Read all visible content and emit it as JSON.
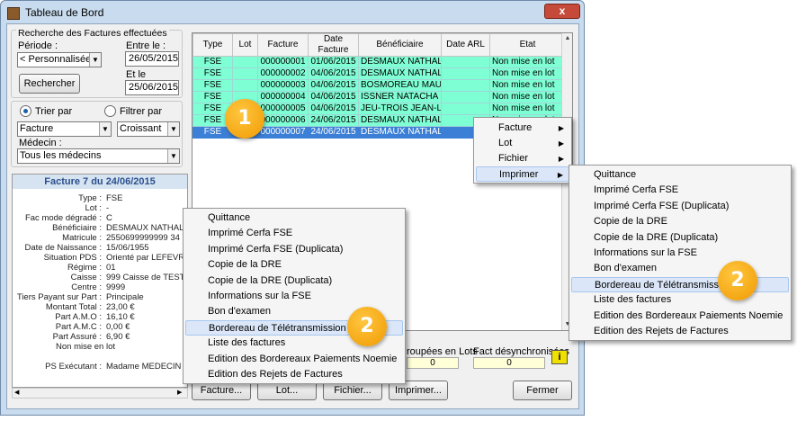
{
  "window": {
    "title": "Tableau de Bord",
    "close_label": "x"
  },
  "search": {
    "group_label": "Recherche des Factures effectuées",
    "periode_label": "Période :",
    "periode_value": "< Personnalisée >",
    "date_from_label": "Entre le :",
    "date_from_value": "26/05/2015",
    "date_to_label": "Et le",
    "date_to_value": "25/06/2015",
    "search_button": "Rechercher"
  },
  "sort": {
    "trier_label": "Trier par",
    "filtrer_label": "Filtrer par",
    "field_value": "Facture",
    "order_value": "Croissant",
    "medecin_label": "Médecin :",
    "medecin_value": "Tous les médecins"
  },
  "detail": {
    "header": "Facture 7  du 24/06/2015",
    "rows": [
      {
        "k": "Type :",
        "v": "FSE"
      },
      {
        "k": "Lot :",
        "v": "-"
      },
      {
        "k": "Fac mode dégradé :",
        "v": "C"
      },
      {
        "k": "Bénéficiaire :",
        "v": "DESMAUX NATHALIE"
      },
      {
        "k": "Matricule :",
        "v": "2550699999999 34"
      },
      {
        "k": "Date de Naissance :",
        "v": "15/06/1955"
      },
      {
        "k": "Situation PDS :",
        "v": "Orienté par LEFEVRE PIER"
      },
      {
        "k": "Régime :",
        "v": "01"
      },
      {
        "k": "Caisse :",
        "v": "999 Caisse de TEST"
      },
      {
        "k": "Centre :",
        "v": "9999"
      },
      {
        "k": "Tiers Payant sur Part :",
        "v": "Principale"
      },
      {
        "k": "Montant Total :",
        "v": "23,00 €"
      },
      {
        "k": "Part A.M.O :",
        "v": "16,10 €"
      },
      {
        "k": "Part A.M.C :",
        "v": "0,00 €"
      },
      {
        "k": "Part Assuré :",
        "v": "6,90 €"
      },
      {
        "k": "",
        "v": "Non mise en lot"
      },
      {
        "k": "",
        "v": ""
      },
      {
        "k": "PS Exécutant :",
        "v": "Madame MEDECIN RPPS-A"
      }
    ]
  },
  "grid": {
    "columns": [
      "Type",
      "Lot",
      "Facture",
      "Date Facture",
      "Bénéficiaire",
      "Date ARL",
      "Etat"
    ],
    "rows": [
      {
        "type": "FSE",
        "lot": "",
        "facture": "000000001",
        "date": "01/06/2015",
        "benef": "DESMAUX NATHALIE",
        "arl": "",
        "etat": "Non mise en lot"
      },
      {
        "type": "FSE",
        "lot": "",
        "facture": "000000002",
        "date": "04/06/2015",
        "benef": "DESMAUX NATHALIE",
        "arl": "",
        "etat": "Non mise en lot"
      },
      {
        "type": "FSE",
        "lot": "",
        "facture": "000000003",
        "date": "04/06/2015",
        "benef": "BOSMOREAU MAURICI",
        "arl": "",
        "etat": "Non mise en lot"
      },
      {
        "type": "FSE",
        "lot": "",
        "facture": "000000004",
        "date": "04/06/2015",
        "benef": "ISSNER NATACHA",
        "arl": "",
        "etat": "Non mise en lot"
      },
      {
        "type": "FSE",
        "lot": "",
        "facture": "000000005",
        "date": "04/06/2015",
        "benef": "JEU-TROIS JEAN-LOUI",
        "arl": "",
        "etat": "Non mise en lot"
      },
      {
        "type": "FSE",
        "lot": "",
        "facture": "000000006",
        "date": "24/06/2015",
        "benef": "DESMAUX NATHALIE",
        "arl": "",
        "etat": "Non mise en lot"
      },
      {
        "type": "FSE",
        "lot": "",
        "facture": "000000007",
        "date": "24/06/2015",
        "benef": "DESMAUX NATHALIE",
        "arl": "",
        "etat": "Non mise en lot"
      }
    ]
  },
  "summary": {
    "grouped_label": "roupées en Lots",
    "grouped_value": "0",
    "desync_label": "Fact désynchronisées",
    "desync_value": "0",
    "info_label": "i"
  },
  "bottom_buttons": {
    "facture": "Facture...",
    "lot": "Lot...",
    "fichier": "Fichier...",
    "imprimer": "Imprimer...",
    "fermer": "Fermer"
  },
  "context_menu": {
    "items": [
      "Facture",
      "Lot",
      "Fichier",
      "Imprimer"
    ]
  },
  "print_submenu": {
    "items": [
      "Quittance",
      "Imprimé Cerfa FSE",
      "Imprimé Cerfa FSE (Duplicata)",
      "Copie de la DRE",
      "Copie de la DRE (Duplicata)",
      "Informations sur la FSE",
      "Bon d'examen",
      "Bordereau de Télétransmission",
      "Liste des factures",
      "Edition des Bordereaux Paiements Noemie",
      "Edition des Rejets de Factures"
    ]
  },
  "print_menu": {
    "items": [
      "Quittance",
      "Imprimé Cerfa FSE",
      "Imprimé Cerfa FSE (Duplicata)",
      "Copie de la DRE",
      "Copie de la DRE (Duplicata)",
      "Informations sur la FSE",
      "Bon d'examen",
      "Bordereau de Télétransmission",
      "Liste des factures",
      "Edition des Bordereaux Paiements Noemie",
      "Edition des Rejets de Factures"
    ]
  },
  "callouts": [
    "1",
    "2",
    "2"
  ]
}
